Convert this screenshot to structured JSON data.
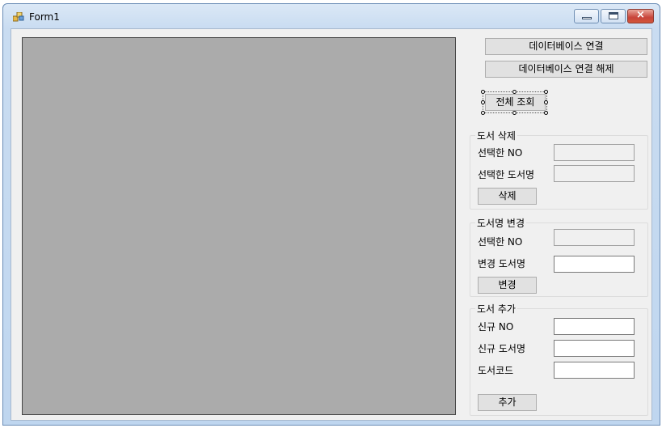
{
  "window": {
    "title": "Form1",
    "controls": {
      "minimize": "",
      "maximize": "",
      "close": "×"
    }
  },
  "toolbar": {
    "connect_label": "데이터베이스 연결",
    "disconnect_label": "데이터베이스 연결 해제",
    "view_all_label": "전체 조회"
  },
  "delete_group": {
    "title": "도서 삭제",
    "selected_no_label": "선택한 NO",
    "selected_name_label": "선택한 도서명",
    "selected_no_value": "",
    "selected_name_value": "",
    "delete_label": "삭제"
  },
  "rename_group": {
    "title": "도서명 변경",
    "selected_no_label": "선택한 NO",
    "new_name_label": "변경 도서명",
    "selected_no_value": "",
    "new_name_value": "",
    "change_label": "변경"
  },
  "add_group": {
    "title": "도서 추가",
    "new_no_label": "신규 NO",
    "new_name_label": "신규 도서명",
    "code_label": "도서코드",
    "new_no_value": "",
    "new_name_value": "",
    "code_value": "",
    "add_label": "추가"
  }
}
